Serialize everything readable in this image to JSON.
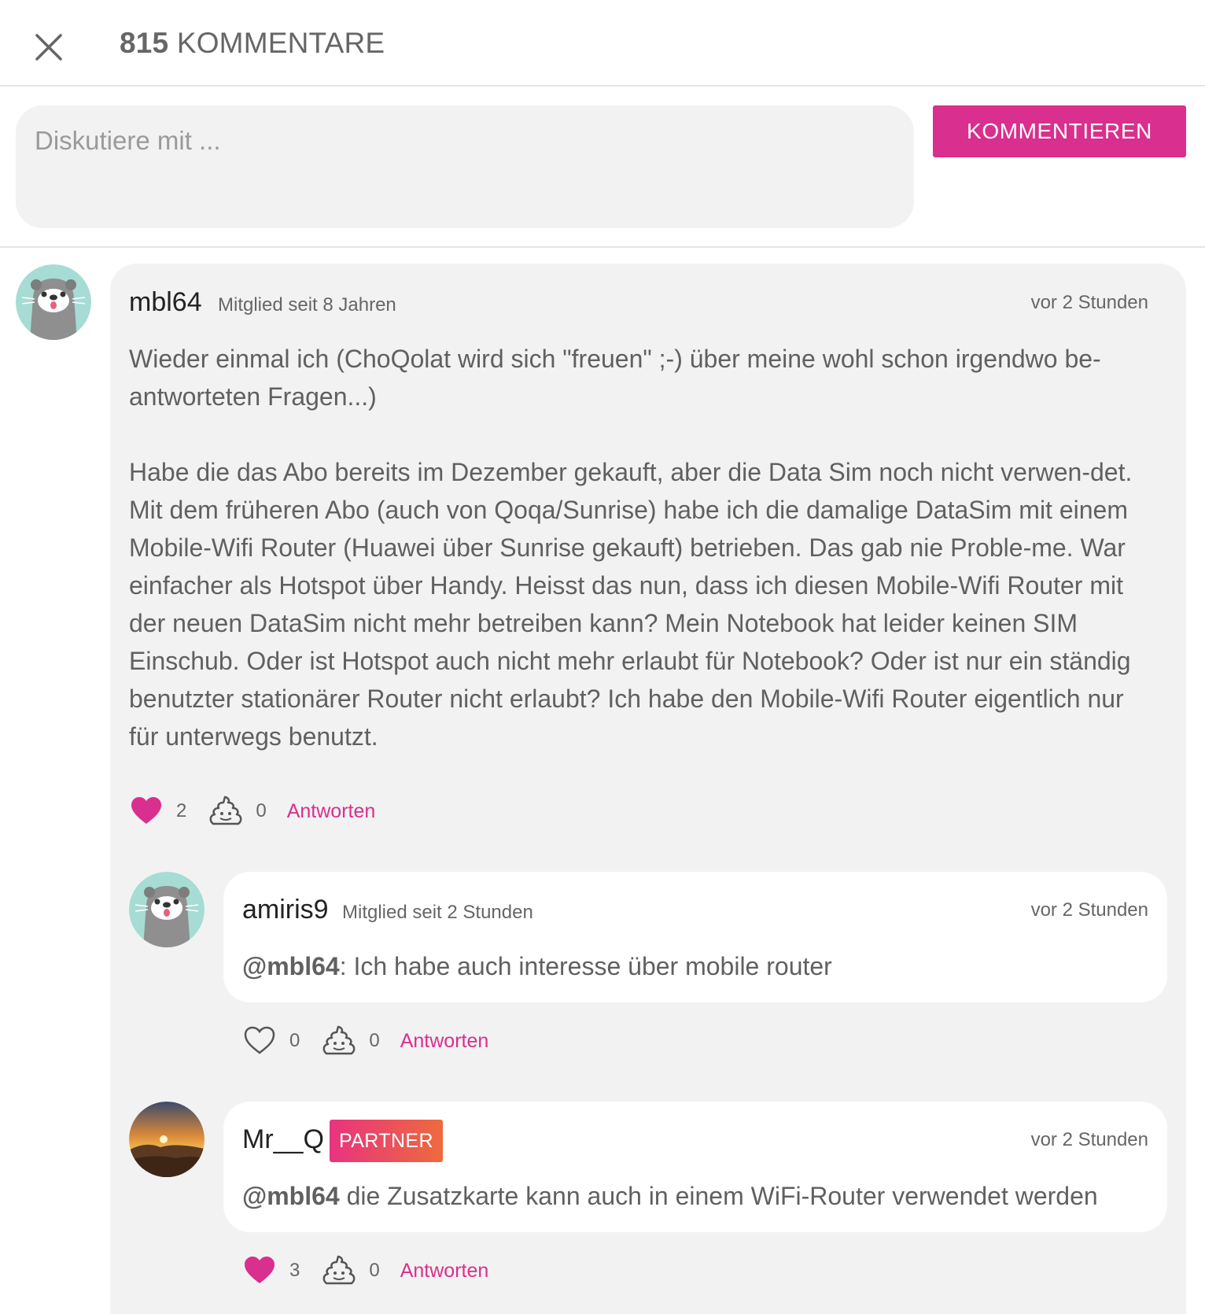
{
  "header": {
    "count": "815",
    "title_rest": " KOMMENTARE"
  },
  "composer": {
    "placeholder": "Diskutiere mit ...",
    "value": "",
    "submit_label": "KOMMENTIEREN"
  },
  "colors": {
    "accent": "#d92f8e",
    "card_bg": "#f2f2f2",
    "text": "#606060"
  },
  "comments": [
    {
      "username": "mbl64",
      "member_since": "Mitglied seit 8 Jahren",
      "time": "vor 2 Stunden",
      "avatar_icon": "otter-avatar",
      "paragraph1": "Wieder einmal ich (ChoQolat wird sich \"freuen\" ;-) über meine wohl schon irgendwo be-antworteten Fragen...)",
      "paragraph2": "Habe die das Abo bereits im Dezember gekauft, aber die Data Sim noch nicht verwen-det. Mit dem früheren Abo (auch von Qoqa/Sunrise) habe ich die damalige DataSim mit einem Mobile-Wifi Router (Huawei über Sunrise gekauft) betrieben. Das gab nie Proble-me. War einfacher als Hotspot über Handy. Heisst das nun, dass ich diesen Mobile-Wifi Router mit der neuen DataSim nicht mehr betreiben kann? Mein Notebook hat leider keinen SIM Einschub. Oder ist Hotspot auch nicht mehr erlaubt für Notebook? Oder ist nur ein ständig benutzter stationärer Router nicht erlaubt? Ich habe den Mobile-Wifi Router eigentlich nur für unterwegs benutzt.",
      "likes": "2",
      "liked": true,
      "poops": "0",
      "reply_label": "Antworten"
    }
  ],
  "replies": [
    {
      "username": "amiris9",
      "member_since": "Mitglied seit 2 Stunden",
      "time": "vor 2 Stunden",
      "avatar_icon": "otter-avatar",
      "mention": "@mbl64",
      "text": ": Ich habe auch interesse über mobile router",
      "likes": "0",
      "liked": false,
      "poops": "0",
      "reply_label": "Antworten"
    },
    {
      "username": "Mr__Q",
      "badge": "PARTNER",
      "time": "vor 2 Stunden",
      "avatar_icon": "sunset-avatar",
      "mention": "@mbl64",
      "text": " die Zusatzkarte kann auch in einem WiFi-Router verwendet werden",
      "likes": "3",
      "liked": true,
      "poops": "0",
      "reply_label": "Antworten"
    }
  ]
}
